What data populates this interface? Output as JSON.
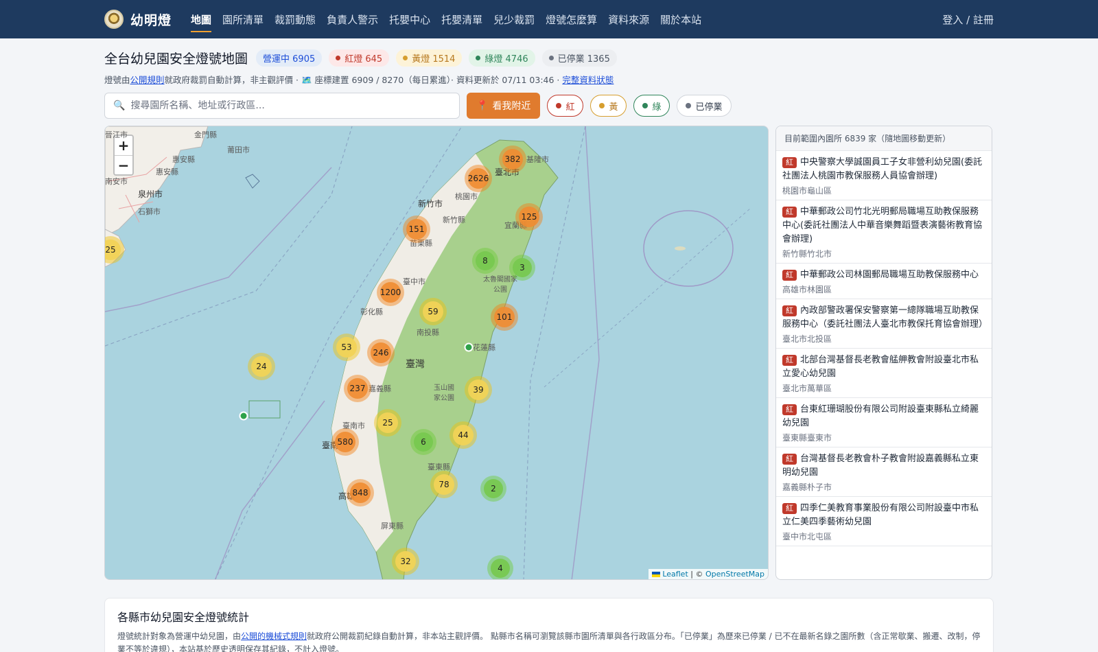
{
  "nav": {
    "brand": "幼明燈",
    "links": [
      "地圖",
      "園所清單",
      "裁罰動態",
      "負責人警示",
      "托嬰中心",
      "托嬰清單",
      "兒少裁罰",
      "燈號怎麼算",
      "資料來源",
      "關於本站"
    ],
    "login": "登入 / 註冊"
  },
  "header": {
    "title": "全台幼兒園安全燈號地圖",
    "badges": {
      "operating": "營運中 6905",
      "red": "紅燈 645",
      "yellow": "黃燈 1514",
      "green": "綠燈 4746",
      "closed": "已停業 1365"
    },
    "sub_prefix": "燈號由",
    "sub_link1": "公開規則",
    "sub_mid": "就政府裁罰自動計算，非主觀評價 · 🗺️ 座標建置 6909 / 8270（每日累進）· 資料更新於 07/11 03:46 ·",
    "sub_link2": "完整資料狀態"
  },
  "search": {
    "placeholder": "搜尋園所名稱、地址或行政區...",
    "near_label": "看我附近",
    "filters": {
      "red": "紅",
      "yellow": "黃",
      "green": "綠",
      "closed": "已停業"
    }
  },
  "colors": {
    "nav": "#1e3a5f",
    "accent": "#e07b2e",
    "red": "#c0392b",
    "yellow": "#d69e2e",
    "green": "#2f855a"
  },
  "map": {
    "zoom_in": "+",
    "zoom_out": "−",
    "labels": {
      "kinmen": "金門縣",
      "putian": "莆田市",
      "jingjiang": "晉江市",
      "huian": "惠安縣",
      "nanan": "南安市",
      "quanzhou": "泉州市",
      "shishi": "石獅市",
      "taipei": "臺北市",
      "keelung": "基隆市",
      "taoyuan": "桃園市",
      "hsinchu": "新竹市",
      "hsinchu_county": "新竹縣",
      "yilan": "宜蘭縣",
      "miaoli": "苗栗縣",
      "taroko": "太魯閣國家公園",
      "taichung": "臺中市",
      "changhua": "彰化縣",
      "nantou": "南投縣",
      "hualien": "花蓮縣",
      "taiwan": "臺灣",
      "chiayi": "嘉義縣",
      "yushan": "玉山國家公園",
      "tainan": "臺南市",
      "taitung": "臺東縣",
      "tainan_short": "臺南",
      "kaohsiung": "高雄",
      "pingtung": "屏東縣"
    },
    "clusters": [
      "382",
      "2626",
      "125",
      "151",
      "8",
      "3",
      "1200",
      "59",
      "101",
      "53",
      "246",
      "24",
      "237",
      "39",
      "25",
      "6",
      "44",
      "580",
      "78",
      "2",
      "848",
      "32",
      "4",
      "25"
    ],
    "attribution_leaflet": "Leaflet",
    "attribution_sep": " | © ",
    "attribution_osm": "OpenStreetMap"
  },
  "sidebar": {
    "header": "目前範圍內園所 6839 家（隨地圖移動更新）",
    "badge": "紅",
    "items": [
      {
        "name": "中央警察大學誠園員工子女非營利幼兒園(委託社團法人桃園市教保服務人員協會辦理)",
        "area": "桃園市龜山區"
      },
      {
        "name": "中華郵政公司竹北光明郵局職場互助教保服務中心(委託社團法人中華音樂舞蹈暨表演藝術教育協會辦理)",
        "area": "新竹縣竹北市"
      },
      {
        "name": "中華郵政公司林園郵局職場互助教保服務中心",
        "area": "高雄市林園區"
      },
      {
        "name": "內政部警政署保安警察第一總隊職場互助教保服務中心（委託社團法人臺北市教保托育協會辦理）",
        "area": "臺北市北投區"
      },
      {
        "name": "北部台灣基督長老教會艋舺教會附設臺北市私立愛心幼兒園",
        "area": "臺北市萬華區"
      },
      {
        "name": "台東紅珊瑚股份有限公司附設臺東縣私立綺麗幼兒園",
        "area": "臺東縣臺東市"
      },
      {
        "name": "台灣基督長老教會朴子教會附設嘉義縣私立東明幼兒園",
        "area": "嘉義縣朴子市"
      },
      {
        "name": "四季仁美教育事業股份有限公司附設臺中市私立仁美四季藝術幼兒園",
        "area": "臺中市北屯區"
      }
    ]
  },
  "stats": {
    "title": "各縣市幼兒園安全燈號統計",
    "p_prefix": "燈號統計對象為營運中幼兒園，由",
    "p_link": "公開的機械式規則",
    "p_rest": "就政府公開裁罰紀錄自動計算，非本站主觀評價。 點縣市名稱可瀏覽該縣市園所清單與各行政區分布。「已停業」為歷來已停業 / 已不在最新名錄之園所數（含正常歇業、搬遷、改制，停業不等於違規），本站基於歷史透明保存其紀錄，不計入燈號。"
  }
}
